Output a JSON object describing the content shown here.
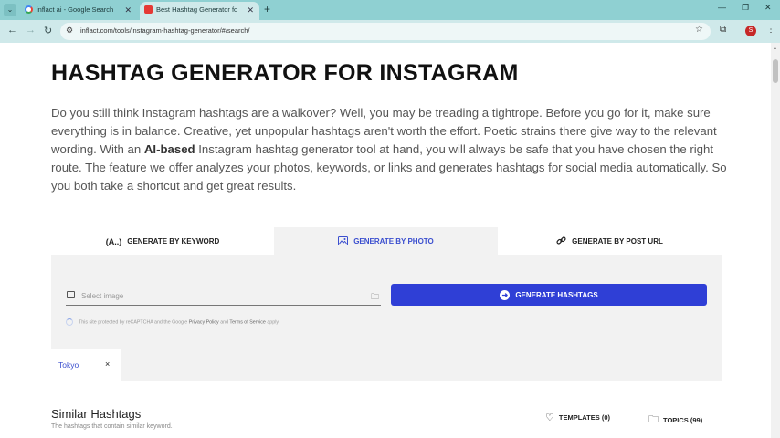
{
  "browser": {
    "tabs": [
      {
        "title": "inflact ai - Google Search",
        "active": false
      },
      {
        "title": "Best Hashtag Generator for Insta",
        "active": true
      }
    ],
    "url": "inflact.com/tools/instagram-hashtag-generator/#/search/",
    "profile_initial": "S"
  },
  "page": {
    "title": "HASHTAG GENERATOR FOR INSTAGRAM",
    "intro_1": "Do you still think Instagram hashtags are a walkover? Well, you may be treading a tightrope. Before you go for it, make sure everything is in balance. Creative, yet unpopular hashtags aren't worth the effort. Poetic strains there give way to the relevant wording. With an ",
    "intro_bold": "AI-based",
    "intro_2": " Instagram hashtag generator tool at hand, you will always be safe that you have chosen the right route. The feature we offer analyzes your photos, keywords, or links and generates hashtags for social media automatically. So you both take a shortcut and get great results."
  },
  "generator": {
    "tabs": [
      {
        "label": "GENERATE BY KEYWORD",
        "icon": "(A..)"
      },
      {
        "label": "GENERATE BY PHOTO",
        "icon": "image-icon",
        "active": true
      },
      {
        "label": "GENERATE BY POST URL",
        "icon": "link-icon"
      }
    ],
    "file_placeholder": "Select image",
    "button_label": "GENERATE HASHTAGS",
    "recaptcha_text": "This site protected by reCAPTCHA and the Google",
    "privacy_link": "Privacy Policy",
    "and_text": "and",
    "terms_link": "Terms of Service",
    "apply_text": "apply",
    "chip_label": "Tokyo",
    "chip_close": "×"
  },
  "similar": {
    "title": "Similar Hashtags",
    "subtitle": "The hashtags that contain similar keyword.",
    "templates_label": "TEMPLATES (0)",
    "topics_label": "TOPICS (99)"
  },
  "colors": {
    "accent": "#2f3fd6",
    "tabbar": "#8fd0d2",
    "panel": "#f2f2f2"
  }
}
